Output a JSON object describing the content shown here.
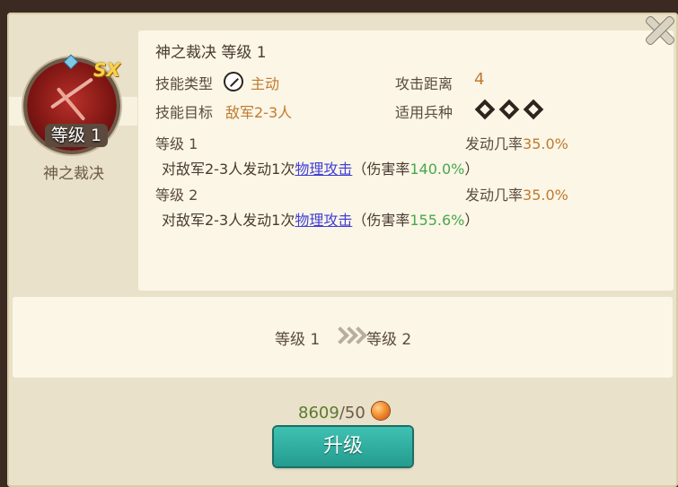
{
  "skill": {
    "name": "神之裁决",
    "level_label": "等级 1",
    "grade": "SX",
    "title": "神之裁决 等级 1",
    "type_label": "技能类型",
    "type_value": "主动",
    "range_label": "攻击距离",
    "range_value": "4",
    "target_label": "技能目标",
    "target_value": "敌军2-3人",
    "troops_label": "适用兵种",
    "icons": {
      "type": "sword-circle-icon",
      "troops": [
        "sword-troop-icon",
        "cavalry-troop-icon",
        "archer-troop-icon"
      ]
    }
  },
  "levels": [
    {
      "head": "等级 1",
      "rate_label": "发动几率",
      "rate_value": "35.0%",
      "desc_pre": "对敌军2-3人发动1次",
      "desc_link": "物理攻击",
      "desc_mid": "（伤害率",
      "desc_pct": "140.0%",
      "desc_post": "）"
    },
    {
      "head": "等级 2",
      "rate_label": "发动几率",
      "rate_value": "35.0%",
      "desc_pre": "对敌军2-3人发动1次",
      "desc_link": "物理攻击",
      "desc_mid": "（伤害率",
      "desc_pct": "155.6%",
      "desc_post": "）"
    }
  ],
  "upgrade": {
    "from": "等级 1",
    "to": "等级 2",
    "cost_have": "8609",
    "cost_sep_need": "/50",
    "button": "升级"
  },
  "colors": {
    "accent_orange": "#c07a30",
    "link_blue": "#4140d6",
    "percent_green": "#48a84c",
    "button_teal": "#2fb0a2"
  }
}
